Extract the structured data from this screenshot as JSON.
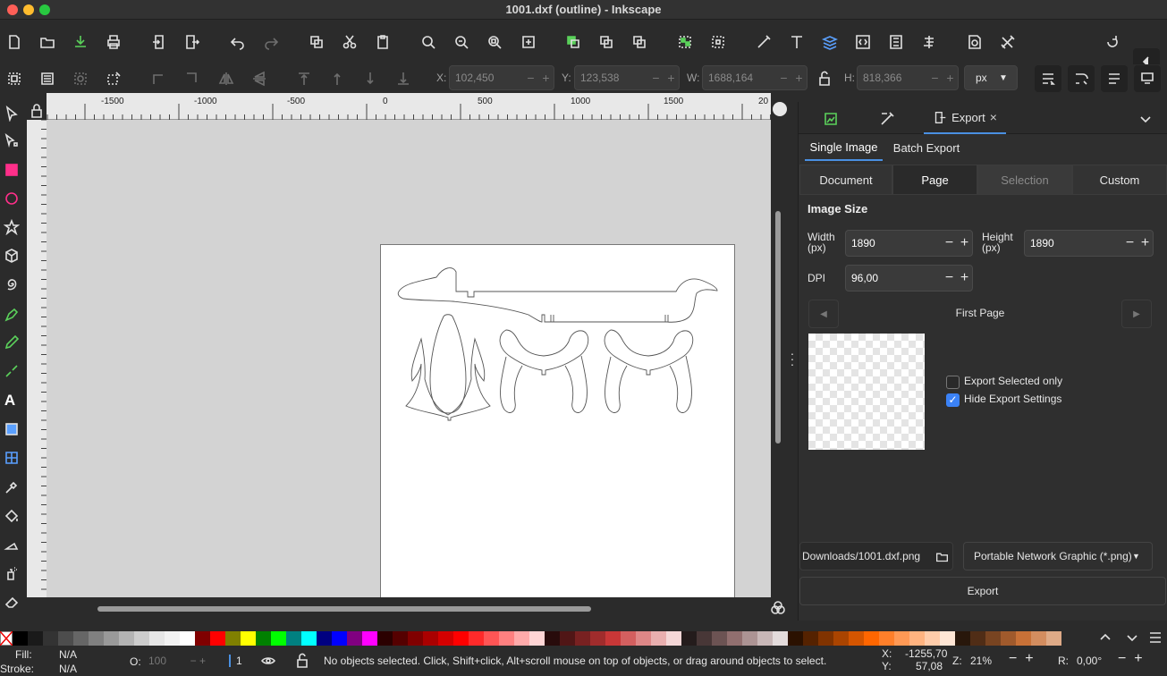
{
  "window": {
    "title": "1001.dxf (outline) - Inkscape"
  },
  "toolbar": {
    "x_label": "X:",
    "x_value": "102,450",
    "y_label": "Y:",
    "y_value": "123,538",
    "w_label": "W:",
    "w_value": "1688,164",
    "h_label": "H:",
    "h_value": "818,366",
    "unit": "px"
  },
  "ruler": {
    "h_ticks": [
      "-1500",
      "-1000",
      "-500",
      "0",
      "500",
      "1000",
      "1500",
      "20"
    ]
  },
  "panel": {
    "tab_export": "Export",
    "subtabs": [
      "Single Image",
      "Batch Export"
    ],
    "areas": [
      "Document",
      "Page",
      "Selection",
      "Custom"
    ],
    "image_size": "Image Size",
    "width_label": "Width (px)",
    "width_value": "1890",
    "height_label": "Height (px)",
    "height_value": "1890",
    "dpi_label": "DPI",
    "dpi_value": "96,00",
    "page_name": "First Page",
    "export_selected_only": "Export Selected only",
    "hide_export_settings": "Hide Export Settings",
    "hide_export_settings_checked": true,
    "export_selected_only_checked": false,
    "filename": "Downloads/1001.dxf.png",
    "filetype": "Portable Network Graphic (*.png)",
    "export_button": "Export"
  },
  "status": {
    "fill_label": "Fill:",
    "fill_value": "N/A",
    "stroke_label": "Stroke:",
    "stroke_value": "N/A",
    "opacity_label": "O:",
    "opacity_value": "100",
    "layer_value": "1",
    "message": "No objects selected. Click, Shift+click, Alt+scroll mouse on top of objects, or drag around objects to select.",
    "x_label": "X:",
    "x_value": "-1255,70",
    "y_label": "Y:",
    "y_value": "57,08",
    "zoom_label": "Z:",
    "zoom_value": "21%",
    "rotate_label": "R:",
    "rotate_value": "0,00°"
  },
  "palette": [
    "#000000",
    "#1a1a1a",
    "#333333",
    "#4d4d4d",
    "#666666",
    "#808080",
    "#999999",
    "#b3b3b3",
    "#cccccc",
    "#e6e6e6",
    "#f2f2f2",
    "#ffffff",
    "#800000",
    "#ff0000",
    "#808000",
    "#ffff00",
    "#008000",
    "#00ff00",
    "#008080",
    "#00ffff",
    "#000080",
    "#0000ff",
    "#800080",
    "#ff00ff",
    "#2b0000",
    "#550000",
    "#800000",
    "#aa0000",
    "#d40000",
    "#ff0000",
    "#ff2a2a",
    "#ff5555",
    "#ff8080",
    "#ffaaaa",
    "#ffd5d5",
    "#280b0b",
    "#501616",
    "#782121",
    "#a02c2c",
    "#c83737",
    "#d35f5f",
    "#de8787",
    "#e9afaf",
    "#f4d7d7",
    "#241c1c",
    "#483737",
    "#6c5353",
    "#916f6f",
    "#ac9393",
    "#c8b7b7",
    "#e3dbdb",
    "#2b1100",
    "#552200",
    "#803300",
    "#aa4400",
    "#d45500",
    "#ff6600",
    "#ff7f2a",
    "#ff9955",
    "#ffb380",
    "#ffccaa",
    "#ffe6d5",
    "#28170b",
    "#502d16",
    "#784421",
    "#a05a2c",
    "#c87137",
    "#d38d5f",
    "#deaa87"
  ]
}
